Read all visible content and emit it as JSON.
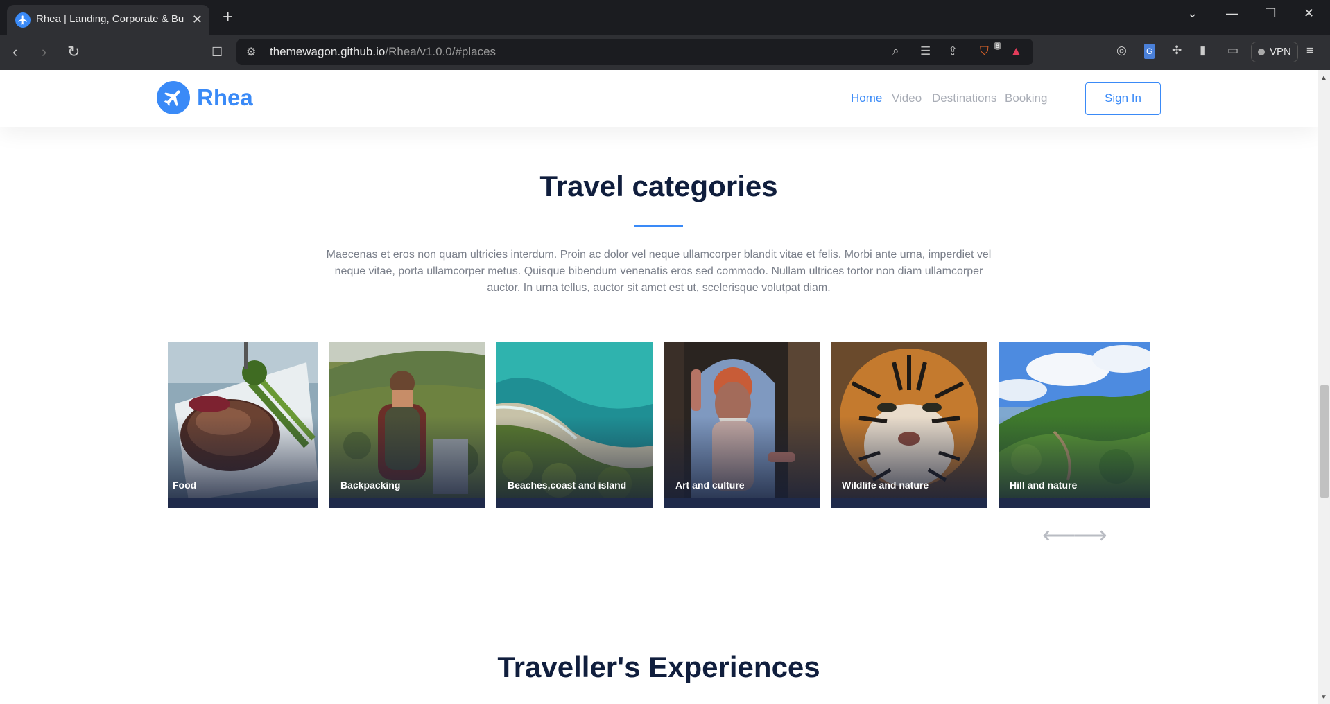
{
  "browser": {
    "tab_title": "Rhea | Landing, Corporate & Bu",
    "url_host": "themewagon.github.io",
    "url_path": "/Rhea/v1.0.0/#places",
    "vpn_label": "VPN",
    "shield_badge": "8"
  },
  "site": {
    "brand": "Rhea",
    "nav": [
      "Home",
      "Video",
      "Destinations",
      "Booking"
    ],
    "signin_label": "Sign In",
    "accent_color": "#3a8af7",
    "heading_color": "#101e3d"
  },
  "categories_section": {
    "title": "Travel categories",
    "lead": "Maecenas et eros non quam ultricies interdum. Proin ac dolor vel neque ullamcorper blandit vitae et felis. Morbi ante urna, imperdiet vel neque vitae, porta ullamcorper metus. Quisque bibendum venenatis eros sed commodo. Nullam ultrices tortor non diam ullamcorper auctor. In urna tellus, auctor sit amet est ut, scelerisque volutpat diam.",
    "cards": [
      {
        "label": "Food"
      },
      {
        "label": "Backpacking"
      },
      {
        "label": "Beaches,coast and island"
      },
      {
        "label": "Art and culture"
      },
      {
        "label": "Wildlife and nature"
      },
      {
        "label": "Hill and nature"
      }
    ],
    "prev_icon": "arrow-left-icon",
    "next_icon": "arrow-right-icon"
  },
  "experiences_section": {
    "title": "Traveller's Experiences"
  }
}
